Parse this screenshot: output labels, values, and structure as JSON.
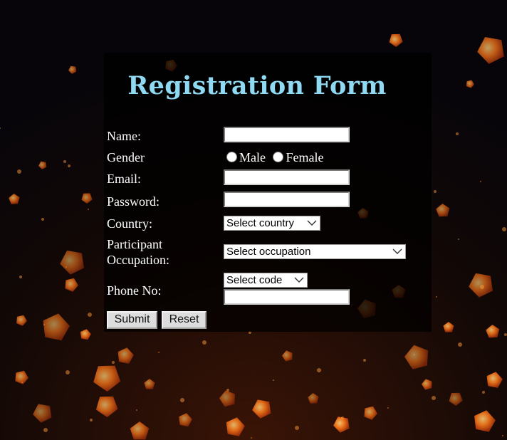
{
  "form": {
    "title": "Registration Form",
    "name_label": "Name:",
    "name_value": "",
    "gender_label": "Gender",
    "gender_options": [
      "Male",
      "Female"
    ],
    "email_label": "Email:",
    "email_value": "",
    "password_label": "Password:",
    "password_value": "",
    "country_label": "Country:",
    "country_select": "Select country",
    "occupation_label_line1": "Participant",
    "occupation_label_line2": "Occupation:",
    "occupation_select": "Select occupation",
    "phone_label": "Phone No:",
    "phone_code_select": "Select code",
    "phone_value": "",
    "submit_label": "Submit",
    "reset_label": "Reset"
  },
  "colors": {
    "title": "#8fd9f3",
    "label": "#ffffff",
    "panel": "rgba(0,0,0,0.72)",
    "background": "#07050a",
    "ember": "#ff7a1a"
  },
  "icons": {
    "dropdown": "chevron-down-icon",
    "radio": "radio-unselected-icon"
  }
}
